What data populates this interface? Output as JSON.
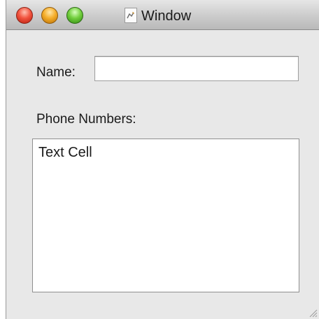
{
  "window": {
    "title": "Window",
    "controls": {
      "close": "close-button",
      "minimize": "minimize-button",
      "zoom": "zoom-button"
    }
  },
  "form": {
    "name_label": "Name:",
    "name_value": "",
    "phone_label": "Phone Numbers:"
  },
  "phone_table": {
    "rows": [
      "Text Cell"
    ]
  },
  "colors": {
    "window_background": "#e8e8e8",
    "close": "#f2543f",
    "minimize": "#f5ae2b",
    "zoom": "#73cf3e"
  },
  "icons": {
    "proxy": "document-proxy-icon",
    "resize": "resize-grip-icon"
  }
}
